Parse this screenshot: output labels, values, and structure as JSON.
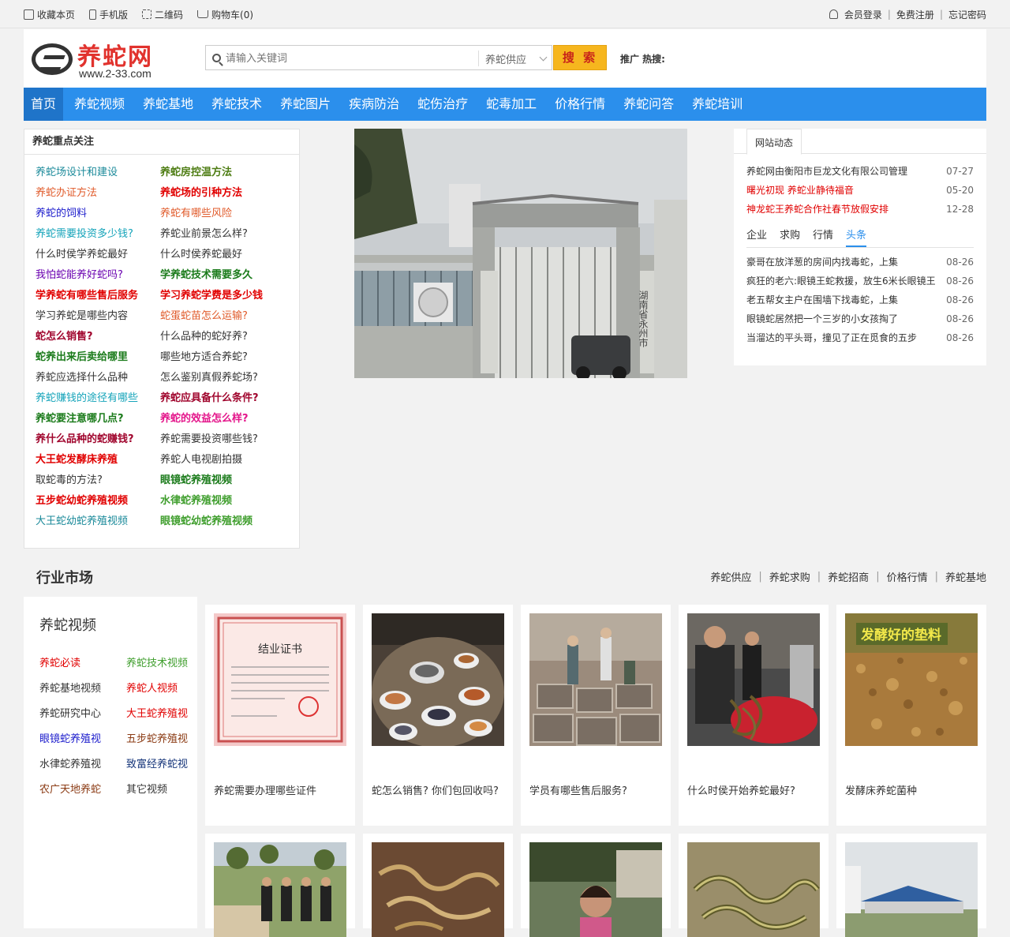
{
  "topbar": {
    "left": [
      "收藏本页",
      "手机版",
      "二维码",
      "购物车(0)"
    ],
    "login": "会员登录",
    "register": "免费注册",
    "forgot": "忘记密码"
  },
  "header": {
    "logo_name": "养蛇网",
    "logo_url": "www.2-33.com",
    "search_placeholder": "请输入关键词",
    "search_category": "养蛇供应",
    "search_button": "搜 索",
    "hot_label": "推广 热搜:"
  },
  "nav": [
    "首页",
    "养蛇视频",
    "养蛇基地",
    "养蛇技术",
    "养蛇图片",
    "疾病防治",
    "蛇伤治疗",
    "蛇毒加工",
    "价格行情",
    "养蛇问答",
    "养蛇培训"
  ],
  "focus": {
    "title": "养蛇重点关注",
    "links": [
      {
        "t": "养蛇场设计和建设",
        "c": "c-cyan",
        "b": false
      },
      {
        "t": "养蛇房控温方法",
        "c": "c-olive",
        "b": true
      },
      {
        "t": "养蛇办证方法",
        "c": "c-orange",
        "b": false
      },
      {
        "t": "养蛇场的引种方法",
        "c": "c-red",
        "b": true
      },
      {
        "t": "养蛇的饲料",
        "c": "c-blue",
        "b": false
      },
      {
        "t": "养蛇有哪些风险",
        "c": "c-orange",
        "b": false
      },
      {
        "t": "养蛇需要投资多少钱?",
        "c": "c-teal",
        "b": false
      },
      {
        "t": "养蛇业前景怎么样?",
        "c": "c-dark",
        "b": false
      },
      {
        "t": "什么时侯学养蛇最好",
        "c": "c-dark",
        "b": false
      },
      {
        "t": "什么时侯养蛇最好",
        "c": "c-dark",
        "b": false
      },
      {
        "t": "我怕蛇能养好蛇吗?",
        "c": "c-purple",
        "b": false
      },
      {
        "t": "学养蛇技术需要多久",
        "c": "c-green",
        "b": true
      },
      {
        "t": "学养蛇有哪些售后服务",
        "c": "c-red",
        "b": true
      },
      {
        "t": "学习养蛇学费是多少钱",
        "c": "c-red",
        "b": true
      },
      {
        "t": "学习养蛇是哪些内容",
        "c": "c-dark",
        "b": false
      },
      {
        "t": "蛇蛋蛇苗怎么运输?",
        "c": "c-orange",
        "b": false
      },
      {
        "t": "蛇怎么销售?",
        "c": "c-maroon",
        "b": true
      },
      {
        "t": "什么品种的蛇好养?",
        "c": "c-dark",
        "b": false
      },
      {
        "t": "蛇养出来后卖给哪里",
        "c": "c-green",
        "b": true
      },
      {
        "t": "哪些地方适合养蛇?",
        "c": "c-dark",
        "b": false
      },
      {
        "t": "养蛇应选择什么品种",
        "c": "c-dark",
        "b": false
      },
      {
        "t": "怎么鉴别真假养蛇场?",
        "c": "c-dark",
        "b": false
      },
      {
        "t": "养蛇赚钱的途径有哪些",
        "c": "c-teal",
        "b": false
      },
      {
        "t": "养蛇应具备什么条件?",
        "c": "c-maroon",
        "b": true
      },
      {
        "t": "养蛇要注意哪几点?",
        "c": "c-green",
        "b": true
      },
      {
        "t": "养蛇的效益怎么样?",
        "c": "c-pink",
        "b": true
      },
      {
        "t": "养什么品种的蛇赚钱?",
        "c": "c-maroon",
        "b": true
      },
      {
        "t": "养蛇需要投资哪些钱?",
        "c": "c-dark",
        "b": false
      },
      {
        "t": "大王蛇发酵床养殖",
        "c": "c-red",
        "b": true
      },
      {
        "t": "养蛇人电视剧拍摄",
        "c": "c-dark",
        "b": false
      },
      {
        "t": "取蛇毒的方法?",
        "c": "c-dark",
        "b": false
      },
      {
        "t": "眼镜蛇养殖视频",
        "c": "c-green",
        "b": true
      },
      {
        "t": "五步蛇幼蛇养殖视频",
        "c": "c-red",
        "b": true
      },
      {
        "t": "水律蛇养殖视频",
        "c": "c-lgreen",
        "b": true
      },
      {
        "t": "大王蛇幼蛇养殖视频",
        "c": "c-cyan",
        "b": false
      },
      {
        "t": "眼镜蛇幼蛇养殖视频",
        "c": "c-lgreen",
        "b": true
      }
    ]
  },
  "news": {
    "tab": "网站动态",
    "items": [
      {
        "t": "养蛇网由衡阳市巨龙文化有限公司管理",
        "d": "07-27",
        "c": "c-dark"
      },
      {
        "t": "曙光初现 养蛇业静待福音",
        "d": "05-20",
        "c": "c-red"
      },
      {
        "t": "神龙蛇王养蛇合作社春节放假安排",
        "d": "12-28",
        "c": "c-red"
      }
    ],
    "tabs2": [
      "企业",
      "求购",
      "行情",
      "头条"
    ],
    "active_tab2": "头条",
    "items2": [
      {
        "t": "豪哥在放洋葱的房间内找毒蛇，上集",
        "d": "08-26"
      },
      {
        "t": "疯狂的老六:眼镜王蛇救援，放生6米长眼镜王",
        "d": "08-26"
      },
      {
        "t": "老五帮女主户在围墙下找毒蛇，上集",
        "d": "08-26"
      },
      {
        "t": "眼镜蛇居然把一个三岁的小女孩掏了",
        "d": "08-26"
      },
      {
        "t": "当溜达的平头哥，撞见了正在觅食的五步",
        "d": "08-26"
      }
    ]
  },
  "market": {
    "title": "行业市场",
    "links": [
      "养蛇供应",
      "养蛇求购",
      "养蛇招商",
      "价格行情",
      "养蛇基地"
    ]
  },
  "videos": {
    "title": "养蛇视频",
    "links": [
      {
        "t": "养蛇必读",
        "c": "c-red"
      },
      {
        "t": "养蛇技术视频",
        "c": "c-lgreen"
      },
      {
        "t": "养蛇基地视频",
        "c": "c-dark"
      },
      {
        "t": "养蛇人视频",
        "c": "c-red"
      },
      {
        "t": "养蛇研究中心",
        "c": "c-dark"
      },
      {
        "t": "大王蛇养殖视",
        "c": "c-red"
      },
      {
        "t": "眼镜蛇养殖视",
        "c": "c-blue"
      },
      {
        "t": "五步蛇养殖视",
        "c": "c-brown"
      },
      {
        "t": "水律蛇养殖视",
        "c": "c-dark"
      },
      {
        "t": "致富经养蛇视",
        "c": "c-navy"
      },
      {
        "t": "农广天地养蛇",
        "c": "c-brown"
      },
      {
        "t": "其它视频",
        "c": "c-dark"
      }
    ]
  },
  "cards": [
    {
      "cap": "养蛇需要办理哪些证件",
      "img": "cert-image"
    },
    {
      "cap": "蛇怎么销售? 你们包回收吗?",
      "img": "banquet-image"
    },
    {
      "cap": "学员有哪些售后服务?",
      "img": "farm-pens-image"
    },
    {
      "cap": "什么时侯开始养蛇最好?",
      "img": "farmer-snakes-image"
    },
    {
      "cap": "发酵床养蛇菌种",
      "img": "sawdust-image",
      "overlay": "发酵好的垫料"
    }
  ],
  "photo_sign": "湖南省永州市",
  "cert_title": "结业证书"
}
